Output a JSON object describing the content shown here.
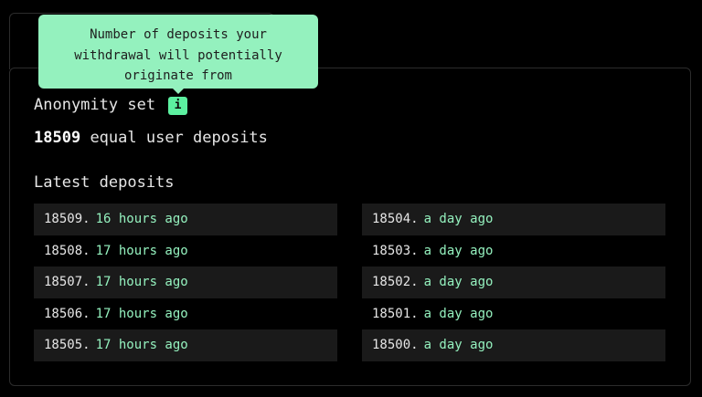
{
  "tooltip": {
    "text": "Number of deposits your\nwithdrawal will potentially\noriginate from"
  },
  "anonymity": {
    "label": "Anonymity set",
    "info_badge": "i",
    "count": "18509",
    "count_suffix": "equal user deposits"
  },
  "latest": {
    "heading": "Latest deposits",
    "left": [
      {
        "id": "18509.",
        "time": "16 hours ago"
      },
      {
        "id": "18508.",
        "time": "17 hours ago"
      },
      {
        "id": "18507.",
        "time": "17 hours ago"
      },
      {
        "id": "18506.",
        "time": "17 hours ago"
      },
      {
        "id": "18505.",
        "time": "17 hours ago"
      }
    ],
    "right": [
      {
        "id": "18504.",
        "time": "a day ago"
      },
      {
        "id": "18503.",
        "time": "a day ago"
      },
      {
        "id": "18502.",
        "time": "a day ago"
      },
      {
        "id": "18501.",
        "time": "a day ago"
      },
      {
        "id": "18500.",
        "time": "a day ago"
      }
    ]
  },
  "colors": {
    "accent": "#94f1be",
    "badge": "#5cf0a0",
    "background": "#000000",
    "row_shade": "#1a1a1a"
  }
}
